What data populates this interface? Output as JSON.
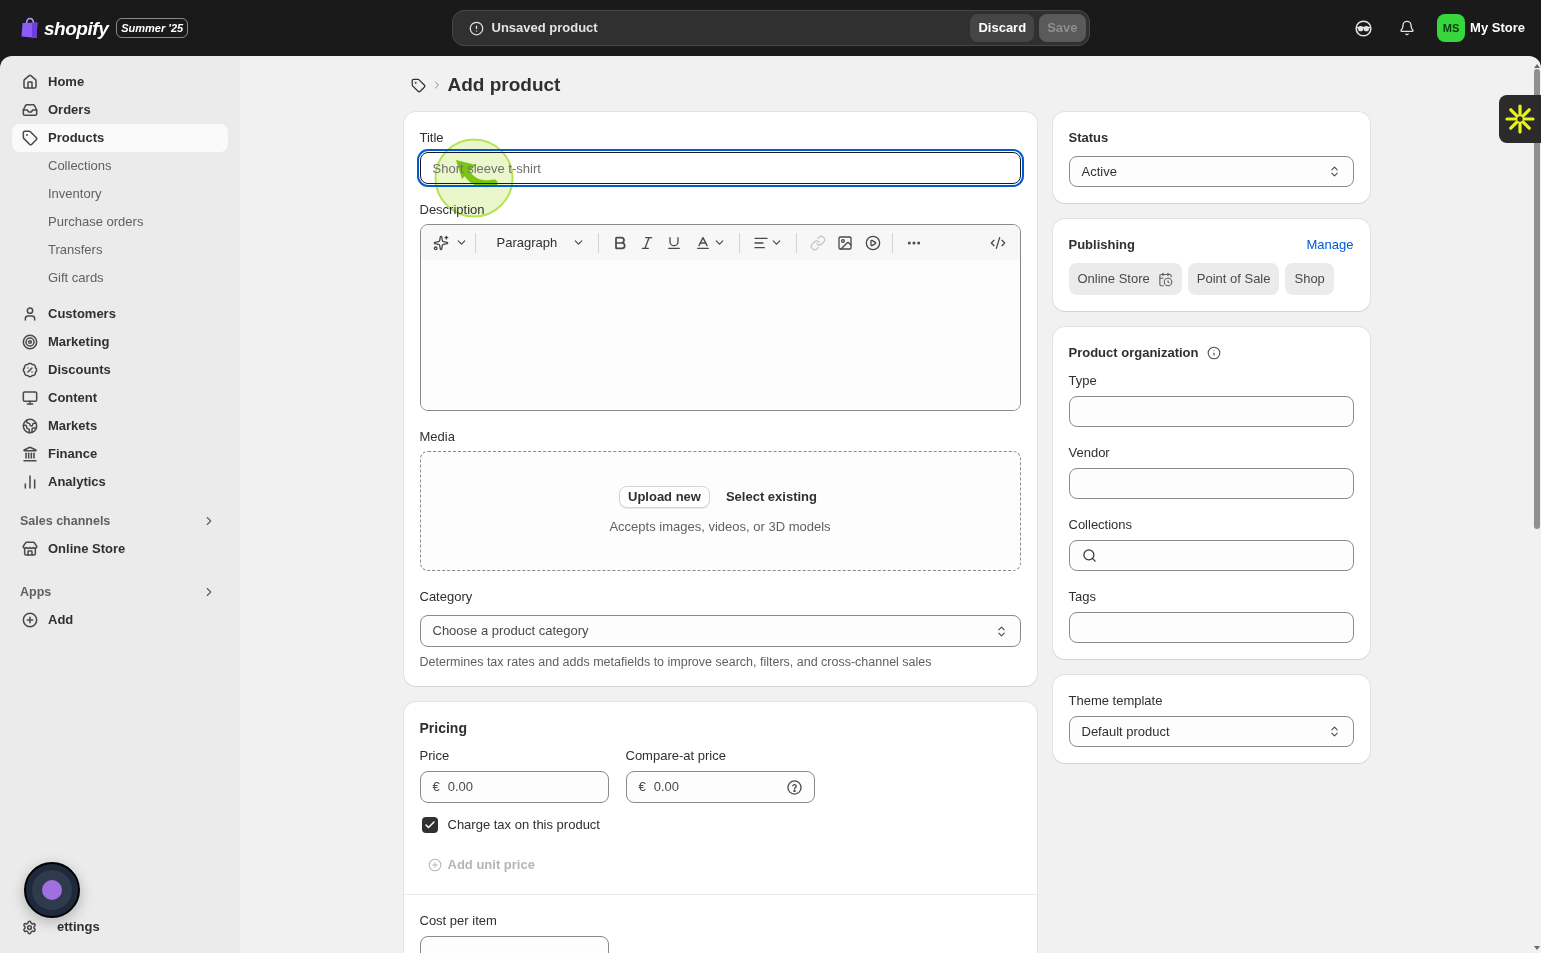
{
  "top_bar": {
    "logo_wordmark": "shopify",
    "edition_badge": "Summer '25",
    "save_bar": {
      "message": "Unsaved product",
      "buttons": [
        {
          "label": "Discard",
          "disabled": false
        },
        {
          "label": "Save",
          "disabled": true
        }
      ]
    },
    "account": {
      "initials": "MS",
      "store_name": "My Store"
    }
  },
  "sidebar": {
    "nav": [
      {
        "label": "Home",
        "selected": false
      },
      {
        "label": "Orders",
        "selected": false
      },
      {
        "label": "Products",
        "selected": true,
        "children": [
          {
            "label": "Collections",
            "selected": false
          },
          {
            "label": "Inventory",
            "selected": false
          },
          {
            "label": "Purchase orders",
            "selected": false
          },
          {
            "label": "Transfers",
            "selected": false
          },
          {
            "label": "Gift cards",
            "selected": false
          }
        ]
      },
      {
        "label": "Customers",
        "selected": false
      },
      {
        "label": "Marketing",
        "selected": false
      },
      {
        "label": "Discounts",
        "selected": false
      },
      {
        "label": "Content",
        "selected": false
      },
      {
        "label": "Markets",
        "selected": false
      },
      {
        "label": "Finance",
        "selected": false
      },
      {
        "label": "Analytics",
        "selected": false
      }
    ],
    "sections": [
      {
        "title": "Sales channels",
        "items": [
          {
            "label": "Online Store",
            "selected": false
          }
        ]
      },
      {
        "title": "Apps",
        "items": [
          {
            "label": "Add",
            "selected": false
          }
        ]
      }
    ],
    "settings": {
      "label": "ettings"
    }
  },
  "page": {
    "title": "Add product"
  },
  "product": {
    "title": {
      "label": "Title",
      "placeholder": "Short sleeve t-shirt",
      "focused": true
    },
    "description": {
      "label": "Description",
      "toolbar": {
        "block_style": "Paragraph",
        "link_disabled": true
      }
    },
    "media": {
      "label": "Media",
      "buttons": [
        {
          "label": "Upload new",
          "kind": "outlined"
        },
        {
          "label": "Select existing",
          "kind": "plain"
        }
      ],
      "hint": "Accepts images, videos, or 3D models"
    },
    "category": {
      "label": "Category",
      "placeholder": "Choose a product category",
      "help": "Determines tax rates and adds metafields to improve search, filters, and cross-channel sales"
    }
  },
  "pricing": {
    "title": "Pricing",
    "fields": [
      {
        "label": "Price",
        "prefix": "€",
        "placeholder": "0.00",
        "help_icon": false
      },
      {
        "label": "Compare-at price",
        "prefix": "€",
        "placeholder": "0.00",
        "help_icon": true
      }
    ],
    "charge_tax": {
      "label": "Charge tax on this product",
      "checked": true
    },
    "add_unit_price": {
      "label": "Add unit price",
      "disabled": true
    },
    "cost_per_item": {
      "label": "Cost per item"
    }
  },
  "status": {
    "title": "Status",
    "value": "Active"
  },
  "publishing": {
    "title": "Publishing",
    "action": "Manage",
    "channels": [
      {
        "label": "Online Store",
        "kind": "iconed"
      },
      {
        "label": "Point of Sale",
        "kind": "plain"
      },
      {
        "label": "Shop",
        "kind": "plain"
      }
    ]
  },
  "organization": {
    "title": "Product organization",
    "fields": [
      {
        "label": "Type",
        "kind": "text"
      },
      {
        "label": "Vendor",
        "kind": "text"
      },
      {
        "label": "Collections",
        "kind": "search"
      },
      {
        "label": "Tags",
        "kind": "text"
      }
    ]
  },
  "theme_template": {
    "label": "Theme template",
    "value": "Default product"
  }
}
